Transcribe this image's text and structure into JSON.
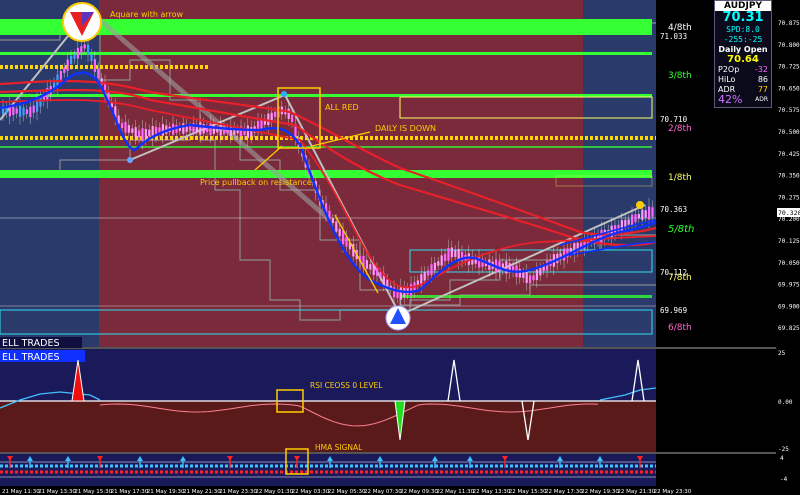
{
  "symbol": "AUDJPY",
  "info_panel": {
    "symbol": "AUDJPY",
    "price": "70.31",
    "spread": "SPD:8.0",
    "change": "-255:-25",
    "daily_open_label": "Daily Open",
    "daily_open_value": "70.64",
    "p2op_label": "P2Op",
    "p2op_value": "-32",
    "hilo_label": "HiLo",
    "hilo_value": "86",
    "adr_label": "ADR",
    "adr_value": "77",
    "adr_pct": "42%",
    "adr_suffix": "ADR"
  },
  "annotations": {
    "aquare_with_arrow": "Aquare with arrow",
    "all_red": "ALL RED",
    "daily_is_down": "DAILY IS DOWN",
    "price_pullback": "Price pullback on resistance",
    "rsi_cross": "RSI CEOSS 0 LEVEL",
    "hma_signal": "HMA SIGNAL"
  },
  "murrey_levels": {
    "l48": "4/8th",
    "l38": "3/8th",
    "l28": "2/8th",
    "l18": "1/8th",
    "l58": "5/8th",
    "l78": "7/8th",
    "l68": "6/8th"
  },
  "level_tags": {
    "t1": "71.033",
    "t2": "70.710",
    "t3": "70.363",
    "t4": "70.112",
    "t5": "69.969"
  },
  "price_axis": [
    "70.875",
    "70.800",
    "70.725",
    "70.650",
    "70.575",
    "70.500",
    "70.425",
    "70.350",
    "70.275",
    "70.200",
    "70.125",
    "70.050",
    "69.975",
    "69.900",
    "69.825"
  ],
  "current_price_tag": "70.320",
  "sell_trades_label_1": "ELL TRADES",
  "sell_trades_label_2": "ELL TRADES",
  "rsi_axis": [
    "25",
    "0.00",
    "-25"
  ],
  "hma_axis": [
    "4",
    "-4"
  ],
  "time_axis": [
    "21 May 11:30",
    "21 May 13:30",
    "21 May 15:30",
    "21 May 17:30",
    "21 May 19:30",
    "21 May 21:30",
    "21 May 23:30",
    "22 May 01:30",
    "22 May 03:30",
    "22 May 05:30",
    "22 May 07:30",
    "22 May 09:30",
    "22 May 11:30",
    "22 May 13:30",
    "22 May 15:30",
    "22 May 17:30",
    "22 May 19:30",
    "22 May 21:30",
    "22 May 23:30"
  ],
  "colors": {
    "background": "#000000",
    "session_red": "#7a2a3a",
    "session_blue": "#2a3a6a",
    "green_zone": "#33ff33",
    "yellow_dots": "#ffd700",
    "red_ma": "#e8202a",
    "blue_ma": "#1030ff",
    "candle_pink": "#ff66ff",
    "candle_cyan": "#40a0ff",
    "annotation": "#ffcc00",
    "rsi_bg_top": "#1a1a5a",
    "rsi_bg_bottom": "#5a1a1a"
  }
}
